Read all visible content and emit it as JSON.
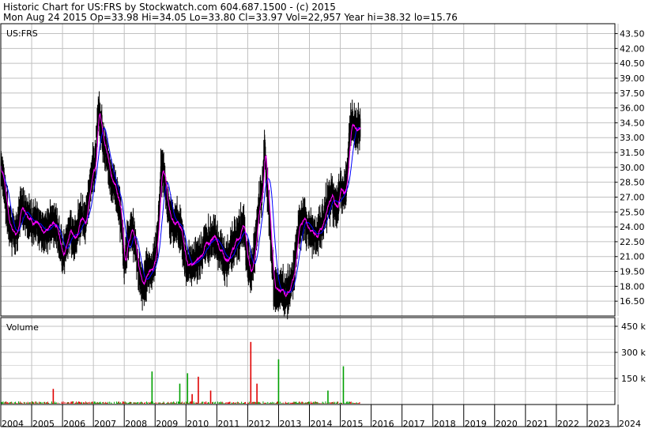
{
  "header": {
    "line1": "Historic Chart for US:FRS by Stockwatch.com 604.687.1500 - (c) 2015",
    "line2": "Mon Aug 24 2015   Op=33.98  Hi=34.05  Lo=33.80  Cl=33.97  Vol=22,957  Year hi=38.32  lo=15.76"
  },
  "colors": {
    "price": "#000000",
    "ma_short": "#ff00ff",
    "ma_long": "#0000ff",
    "vol_up": "#00a000",
    "vol_down": "#e00000",
    "grid": "#c0c0c0"
  },
  "chart_data": [
    {
      "type": "line",
      "title": "US:FRS",
      "ylim": [
        15.0,
        44.5
      ],
      "yticks": [
        "43.50",
        "42.00",
        "40.50",
        "39.00",
        "37.50",
        "36.00",
        "34.50",
        "33.00",
        "31.50",
        "30.00",
        "28.50",
        "27.00",
        "25.50",
        "24.00",
        "22.50",
        "21.00",
        "19.50",
        "18.00",
        "16.50"
      ],
      "x_labels": [
        "2004",
        "2005",
        "2006",
        "2007",
        "2008",
        "2009",
        "2010",
        "2011",
        "2012",
        "2013",
        "2014",
        "2015",
        "2016",
        "2017",
        "2018",
        "2019",
        "2020",
        "2021",
        "2022",
        "2023",
        "2024"
      ],
      "series": [
        {
          "x": [
            2004.0,
            2004.1,
            2004.25,
            2004.4,
            2004.5,
            2004.65,
            2004.8,
            2005.0,
            2005.2,
            2005.4,
            2005.6,
            2005.8,
            2006.0,
            2006.2,
            2006.4,
            2006.6,
            2006.75,
            2006.85,
            2006.95,
            2007.05,
            2007.15,
            2007.3,
            2007.5,
            2007.7,
            2007.9,
            2008.0,
            2008.1,
            2008.25,
            2008.35,
            2008.5,
            2008.6,
            2008.75,
            2008.9,
            2009.0,
            2009.1,
            2009.2,
            2009.3,
            2009.45,
            2009.6,
            2009.8,
            2010.0,
            2010.15,
            2010.3,
            2010.5,
            2010.7,
            2010.9,
            2011.1,
            2011.3,
            2011.5,
            2011.7,
            2011.85,
            2012.0,
            2012.1,
            2012.25,
            2012.35,
            2012.45,
            2012.55,
            2012.7,
            2012.85,
            2013.0,
            2013.1,
            2013.2,
            2013.35,
            2013.5,
            2013.65,
            2013.8,
            2014.0,
            2014.2,
            2014.4,
            2014.55,
            2014.7,
            2014.9,
            2015.0,
            2015.1,
            2015.2,
            2015.35,
            2015.5,
            2015.65
          ],
          "values": [
            30.0,
            28.5,
            24.5,
            23.5,
            23.0,
            26.0,
            25.5,
            24.5,
            24.0,
            23.5,
            24.5,
            24.0,
            21.0,
            23.5,
            23.0,
            25.0,
            24.5,
            27.0,
            29.5,
            30.0,
            36.0,
            33.0,
            30.0,
            28.0,
            25.0,
            20.0,
            22.5,
            24.0,
            22.0,
            19.0,
            18.0,
            19.5,
            20.0,
            20.5,
            24.0,
            30.0,
            29.0,
            25.0,
            24.5,
            24.0,
            20.5,
            20.0,
            20.5,
            21.5,
            22.5,
            23.0,
            21.5,
            20.5,
            22.0,
            23.0,
            24.5,
            20.5,
            19.5,
            22.0,
            26.0,
            27.0,
            32.0,
            25.0,
            18.0,
            17.5,
            18.0,
            17.0,
            17.5,
            19.5,
            24.0,
            25.0,
            23.5,
            23.0,
            24.0,
            26.0,
            27.0,
            26.0,
            28.0,
            27.5,
            28.5,
            34.5,
            34.0,
            34.0
          ]
        }
      ]
    },
    {
      "type": "bar",
      "title": "Volume",
      "ylim": [
        0,
        500
      ],
      "yticks": [
        "450 k",
        "300 k",
        "150 k"
      ],
      "spikes": [
        {
          "x": 2005.7,
          "value": 90,
          "up": false
        },
        {
          "x": 2008.9,
          "value": 190,
          "up": true
        },
        {
          "x": 2009.8,
          "value": 120,
          "up": true
        },
        {
          "x": 2010.05,
          "value": 180,
          "up": true
        },
        {
          "x": 2010.2,
          "value": 60,
          "up": false
        },
        {
          "x": 2010.4,
          "value": 160,
          "up": false
        },
        {
          "x": 2010.8,
          "value": 80,
          "up": false
        },
        {
          "x": 2012.1,
          "value": 360,
          "up": false
        },
        {
          "x": 2012.3,
          "value": 120,
          "up": false
        },
        {
          "x": 2013.0,
          "value": 260,
          "up": true
        },
        {
          "x": 2014.6,
          "value": 80,
          "up": true
        },
        {
          "x": 2015.1,
          "value": 220,
          "up": true
        }
      ]
    }
  ]
}
